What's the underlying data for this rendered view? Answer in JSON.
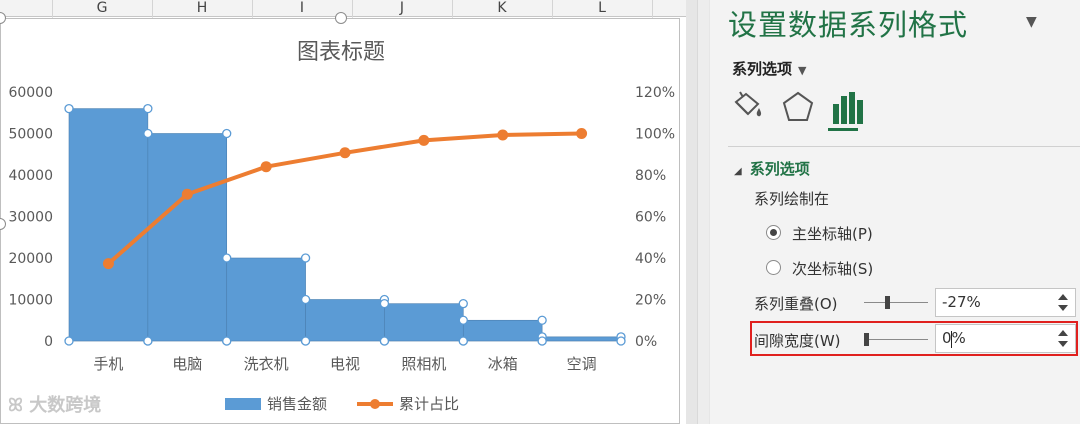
{
  "sheet": {
    "columns": [
      "G",
      "H",
      "I",
      "J",
      "K",
      "L"
    ]
  },
  "chart_data": {
    "type": "bar",
    "title": "图表标题",
    "categories": [
      "手机",
      "电脑",
      "洗衣机",
      "电视",
      "照相机",
      "冰箱",
      "空调"
    ],
    "series": [
      {
        "name": "销售金额",
        "kind": "bar",
        "axis": "primary",
        "color": "#5b9bd5",
        "values": [
          56000,
          50000,
          20000,
          10000,
          9000,
          5000,
          1000
        ]
      },
      {
        "name": "累计占比",
        "kind": "line",
        "axis": "secondary",
        "color": "#ed7d31",
        "values": [
          37.3,
          70.7,
          84.0,
          90.7,
          96.7,
          99.3,
          100.0
        ]
      }
    ],
    "ylim": [
      0,
      60000
    ],
    "yticks": [
      "0",
      "10000",
      "20000",
      "30000",
      "40000",
      "50000",
      "60000"
    ],
    "y2lim": [
      0,
      120
    ],
    "y2ticks": [
      "0%",
      "20%",
      "40%",
      "60%",
      "80%",
      "100%",
      "120%"
    ],
    "gap_width_percent": 0,
    "grid": false,
    "legend": "bottom"
  },
  "pane": {
    "title": "设置数据系列格式",
    "series_options_dropdown": "系列选项",
    "section_title": "系列选项",
    "plot_on_label": "系列绘制在",
    "primary_axis": "主坐标轴(P)",
    "secondary_axis": "次坐标轴(S)",
    "overlap_label": "系列重叠(O)",
    "overlap_value": "-27%",
    "gap_label": "间隙宽度(W)",
    "gap_value": "0%",
    "icons": [
      "fill-bucket-icon",
      "pentagon-effects-icon",
      "bar-chart-options-icon"
    ],
    "accent_color": "#217346",
    "highlight_color": "#e0201e"
  },
  "watermark": "大数跨境"
}
